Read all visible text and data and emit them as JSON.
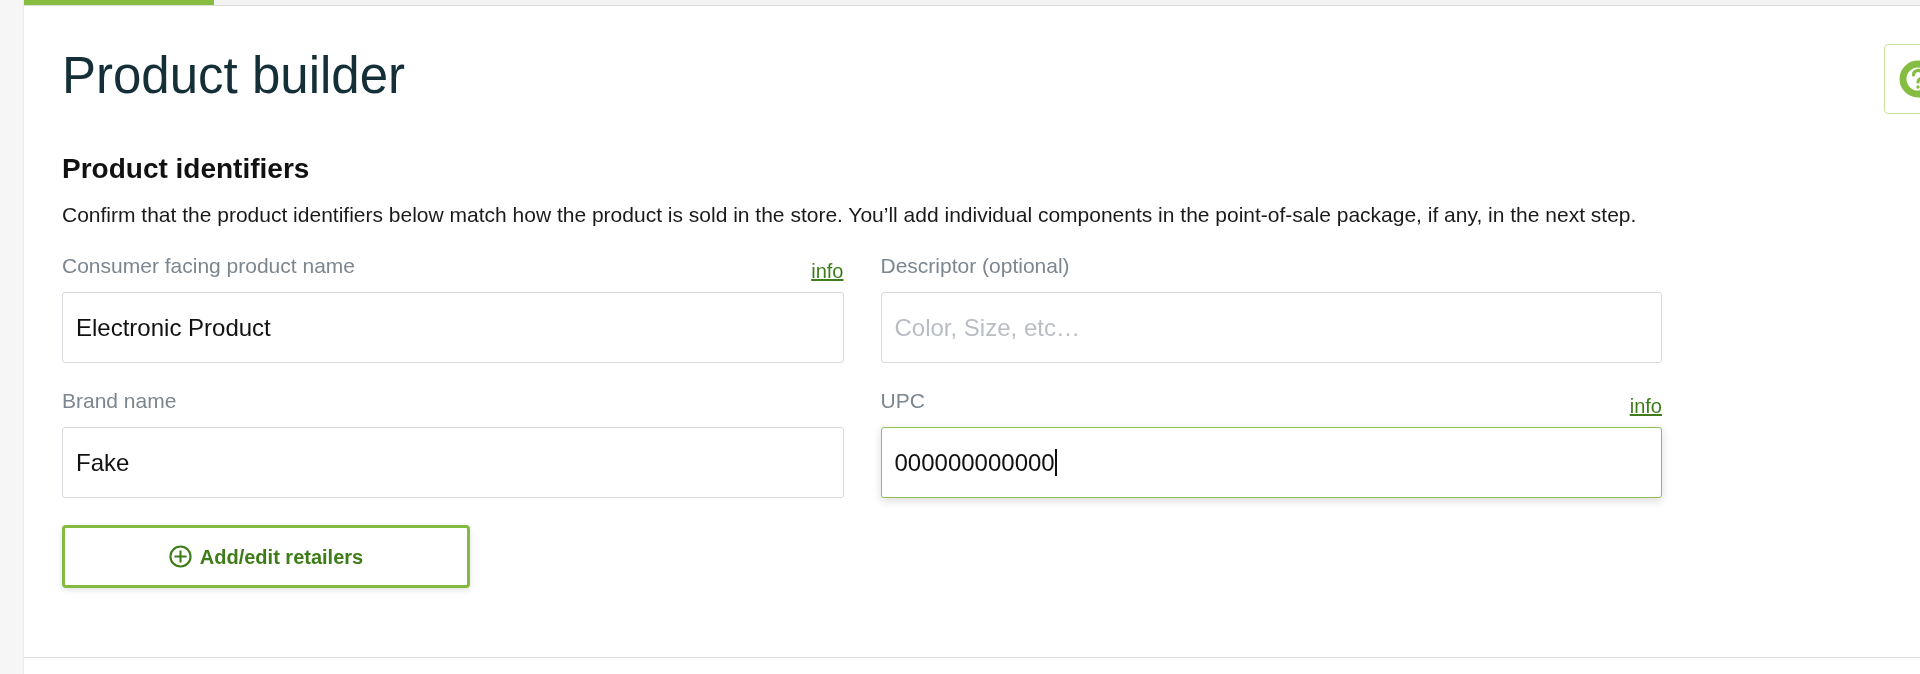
{
  "progress": {
    "level": 0.1
  },
  "page": {
    "title": "Product builder"
  },
  "section": {
    "title": "Product identifiers",
    "description": "Confirm that the product identifiers below match how the product is sold in the store. You’ll add individual components in the point-of-sale package, if any, in the next step."
  },
  "fields": [
    {
      "label": "Consumer facing product name",
      "info": "info",
      "value": "Electronic Product",
      "focused": false
    },
    {
      "label": "Descriptor (optional)",
      "placeholder": "Color, Size, etc…",
      "focused": false
    },
    {
      "label": "Brand name",
      "value": "Fake",
      "focused": false
    },
    {
      "label": "UPC",
      "info": "info",
      "value": "000000000000",
      "focused": true
    }
  ],
  "add_button": {
    "label": "Add/edit retailers"
  }
}
